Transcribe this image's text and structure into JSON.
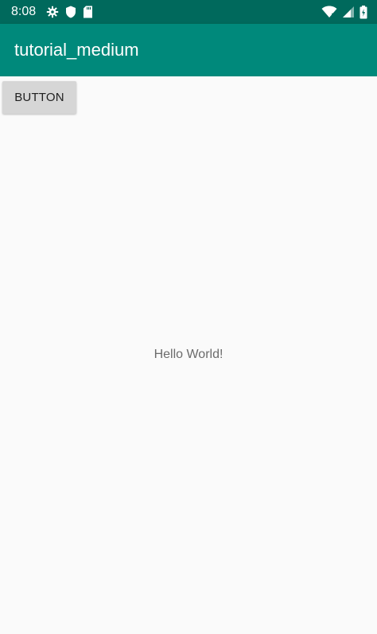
{
  "status_bar": {
    "time": "8:08",
    "icons_left": [
      "gear-icon",
      "shield-icon",
      "sd-card-icon"
    ],
    "icons_right": [
      "wifi-icon",
      "signal-icon",
      "battery-icon"
    ],
    "colors": {
      "background": "#00695c",
      "foreground": "#ffffff"
    }
  },
  "app_bar": {
    "title": "tutorial_medium",
    "background": "#00897b"
  },
  "main": {
    "button_label": "BUTTON",
    "hello_text": "Hello World!",
    "background": "#fafafa"
  }
}
